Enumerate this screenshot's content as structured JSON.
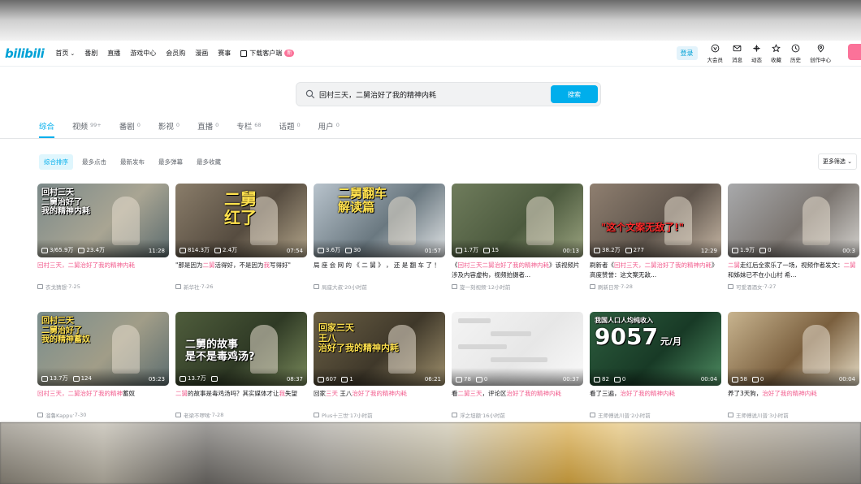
{
  "header": {
    "logo": "bilibili",
    "nav": [
      {
        "label": "首页",
        "chevron": true
      },
      {
        "label": "番剧"
      },
      {
        "label": "直播"
      },
      {
        "label": "游戏中心"
      },
      {
        "label": "会员购"
      },
      {
        "label": "漫画"
      },
      {
        "label": "赛事"
      }
    ],
    "download": {
      "label": "下载客户端",
      "badge": "新"
    },
    "login": "登录",
    "right_nav": [
      {
        "label": "大会员",
        "icon": "vip-icon"
      },
      {
        "label": "消息",
        "icon": "message-icon"
      },
      {
        "label": "动态",
        "icon": "dynamic-icon"
      },
      {
        "label": "收藏",
        "icon": "favorite-icon"
      },
      {
        "label": "历史",
        "icon": "history-icon"
      },
      {
        "label": "创作中心",
        "icon": "creator-icon"
      }
    ]
  },
  "search": {
    "value": "回村三天，二舅治好了我的精神内耗",
    "button": "搜索"
  },
  "tabs": [
    {
      "label": "综合",
      "count": "",
      "active": true
    },
    {
      "label": "视频",
      "count": "99+"
    },
    {
      "label": "番剧",
      "count": "0"
    },
    {
      "label": "影视",
      "count": "0"
    },
    {
      "label": "直播",
      "count": "0"
    },
    {
      "label": "专栏",
      "count": "68"
    },
    {
      "label": "话题",
      "count": "0"
    },
    {
      "label": "用户",
      "count": "0"
    }
  ],
  "filters": [
    {
      "label": "综合排序",
      "active": true
    },
    {
      "label": "最多点击"
    },
    {
      "label": "最新发布"
    },
    {
      "label": "最多弹幕"
    },
    {
      "label": "最多收藏"
    }
  ],
  "more_filters": "更多筛选",
  "videos": [
    {
      "views": "3/65.9万",
      "danmaku": "23.4万",
      "duration": "11:28",
      "title_parts": [
        {
          "t": "回村三天，二舅治好了我的精神内耗",
          "h": true
        }
      ],
      "author": "衣戈猜想",
      "date": "7-25",
      "bg": [
        "#7c8a8a",
        "#a9a593",
        "#5b6b6e"
      ],
      "caption": [
        "回村三天",
        "二舅治好了",
        "我的精神内耗"
      ],
      "capColor": "#ffffff",
      "capStyle": "left"
    },
    {
      "views": "814.3万",
      "danmaku": "2.4万",
      "duration": "07:54",
      "title_parts": [
        {
          "t": "\"那是因为",
          "h": false
        },
        {
          "t": "二舅",
          "h": true
        },
        {
          "t": "活得好，不是因为",
          "h": false
        },
        {
          "t": "我",
          "h": true
        },
        {
          "t": "写得好\"",
          "h": false
        }
      ],
      "author": "新华社",
      "date": "7-26",
      "bg": [
        "#8a7d6a",
        "#564c40",
        "#b3a58a"
      ],
      "caption": [
        "二舅",
        "红了"
      ],
      "capColor": "#ffe14d",
      "capStyle": "big"
    },
    {
      "views": "3.6万",
      "danmaku": "30",
      "duration": "01:57",
      "title_parts": [
        {
          "t": "局 座 会 网 的 《 二 舅 》 ， 还 是 翻 车 了 ！",
          "h": false
        }
      ],
      "author": "局座大叔",
      "date": "20小时前",
      "bg": [
        "#b8c3cc",
        "#6a7880",
        "#e1e4e6"
      ],
      "caption": [
        "二舅翻车",
        "解读篇"
      ],
      "capColor": "#ffe14d",
      "capStyle": "flip"
    },
    {
      "views": "1.7万",
      "danmaku": "15",
      "duration": "00:13",
      "title_parts": [
        {
          "t": "《",
          "h": false
        },
        {
          "t": "回村三天二舅治好了我的精神内耗",
          "h": true
        },
        {
          "t": "》该视频片涉及内容虚构，视频拍摄者...",
          "h": false
        }
      ],
      "author": "旋一刻视频",
      "date": "12小时前",
      "bg": [
        "#6f7c5c",
        "#4c5a3e",
        "#9aa37f"
      ],
      "caption": [],
      "capColor": "#ffffff",
      "capStyle": "none"
    },
    {
      "views": "38.2万",
      "danmaku": "277",
      "duration": "12:29",
      "title_parts": [
        {
          "t": "刷新者《",
          "h": false
        },
        {
          "t": "回村三天，二舅治好了我的精神内耗",
          "h": true
        },
        {
          "t": "》高度赞誉：这文案无敌...",
          "h": false
        }
      ],
      "author": "刷新日常",
      "date": "7-28",
      "bg": [
        "#8f7f70",
        "#5f554c",
        "#c7b7a5"
      ],
      "caption": [
        "\"这个文案无敌了!\""
      ],
      "capColor": "#ff2b2b",
      "capStyle": "wide"
    },
    {
      "views": "1.9万",
      "danmaku": "0",
      "duration": "00:3",
      "title_parts": [
        {
          "t": "二舅",
          "h": true
        },
        {
          "t": "走红后全家乐了一场，视频作者发文：",
          "h": false
        },
        {
          "t": "二舅",
          "h": true
        },
        {
          "t": "和姊妹已不在小山村 希...",
          "h": false
        }
      ],
      "author": "可爱酒酒女",
      "date": "7-27",
      "bg": [
        "#a8a9ab",
        "#7b7570",
        "#d5d3cf"
      ],
      "caption": [],
      "capColor": "#ffffff",
      "capStyle": "none"
    },
    {
      "views": "13.7万",
      "danmaku": "124",
      "duration": "05:23",
      "title_parts": [
        {
          "t": "回村三天，二舅治好了我的精神",
          "h": true
        },
        {
          "t": "蓄奴",
          "h": false
        }
      ],
      "author": "溜鲁Kappu",
      "date": "7-30",
      "bg": [
        "#7b8e8d",
        "#a19d88",
        "#5c6d6f"
      ],
      "caption": [
        "回村三天",
        "二舅治好了",
        "我的精神蓄奴"
      ],
      "capColor": "#ffe14d",
      "capStyle": "left"
    },
    {
      "views": "13.7万",
      "danmaku": "",
      "duration": "08:37",
      "title_parts": [
        {
          "t": "二舅",
          "h": true
        },
        {
          "t": "的故事是毒鸡汤吗？其实媒体才让",
          "h": false
        },
        {
          "t": "我",
          "h": true
        },
        {
          "t": "失望",
          "h": false
        }
      ],
      "author": "老梁不啰嗦",
      "date": "7-28",
      "bg": [
        "#4f5d3c",
        "#2f3a25",
        "#78885a"
      ],
      "caption": [
        "二舅的故事",
        "是不是毒鸡汤?"
      ],
      "capColor": "#ffffff",
      "capStyle": "story"
    },
    {
      "views": "607",
      "danmaku": "1",
      "duration": "06:21",
      "title_parts": [
        {
          "t": "回家",
          "h": false
        },
        {
          "t": "三天",
          "h": true
        },
        {
          "t": " 王八",
          "h": false
        },
        {
          "t": "治好了我的精神内耗",
          "h": true
        }
      ],
      "author": "Plus十三世",
      "date": "17小时前",
      "bg": [
        "#6a5f45",
        "#3f382a",
        "#9e8f6c"
      ],
      "caption": [
        "回家三天",
        "王八",
        "治好了我的精神内耗"
      ],
      "capColor": "#ffe14d",
      "capStyle": "turtle"
    },
    {
      "views": "78",
      "danmaku": "0",
      "duration": "00:37",
      "title_parts": [
        {
          "t": "看",
          "h": false
        },
        {
          "t": "二舅三天",
          "h": true
        },
        {
          "t": "，评论区",
          "h": false
        },
        {
          "t": "治好了我的精神内耗",
          "h": true
        }
      ],
      "author": "浮之坦额",
      "date": "16小时前",
      "bg": [
        "#f4f4f4",
        "#e7e7e7",
        "#fafafa"
      ],
      "caption": [],
      "capColor": "#333333",
      "capStyle": "chat"
    },
    {
      "views": "82",
      "danmaku": "0",
      "duration": "00:04",
      "title_parts": [
        {
          "t": "看了三遍，",
          "h": false
        },
        {
          "t": "治好了我的精神内耗",
          "h": true
        }
      ],
      "author": "王师傅说川普",
      "date": "2小时前",
      "bg": [
        "#2d5d3e",
        "#183a26",
        "#4d8a60"
      ],
      "caption": [
        "我国人口人均纯收入",
        "9057",
        "元/月"
      ],
      "capColor": "#ffffff",
      "capStyle": "income"
    },
    {
      "views": "58",
      "danmaku": "0",
      "duration": "00:04",
      "title_parts": [
        {
          "t": "养了3天狗，",
          "h": false
        },
        {
          "t": "治好了我的精神内耗",
          "h": true
        }
      ],
      "author": "王师傅说川普",
      "date": "3小时前",
      "bg": [
        "#c8b48f",
        "#7a5f3e",
        "#e6dcc5"
      ],
      "caption": [],
      "capColor": "#ffffff",
      "capStyle": "none"
    }
  ]
}
